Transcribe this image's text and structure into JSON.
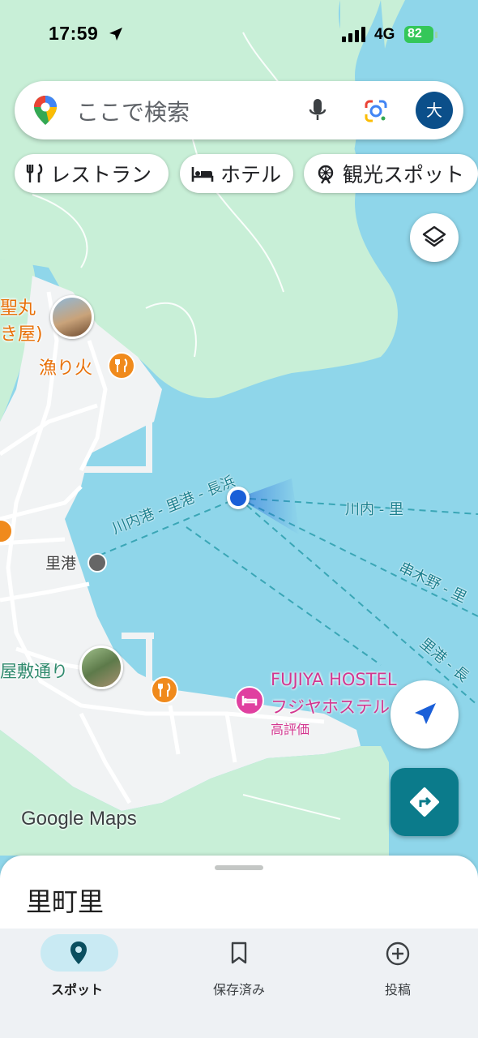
{
  "status_bar": {
    "time": "17:59",
    "network": "4G",
    "battery": "82"
  },
  "search": {
    "placeholder": "ここで検索",
    "avatar_letter": "大"
  },
  "chips": [
    {
      "label": "レストラン",
      "icon": "restaurant-icon"
    },
    {
      "label": "ホテル",
      "icon": "hotel-icon"
    },
    {
      "label": "観光スポット",
      "icon": "attraction-icon"
    }
  ],
  "map": {
    "labels": {
      "seimaru": "聖丸",
      "seimaru_sub": "き屋)",
      "isaribi": "漁り火",
      "satokou": "里港",
      "yashiki": "屋敷通り",
      "hostel_en": "FUJIYA HOSTEL",
      "hostel_jp": "フジヤホステル",
      "hostel_rating": "高評価",
      "watermark": "Google Maps"
    },
    "ferry_routes": {
      "route1": "川内港 - 里港 - 長浜",
      "route2": "川内 - 里",
      "route3": "串木野 - 里",
      "route4": "里港 - 長"
    },
    "colors": {
      "sea": "#8fd6ea",
      "land": "#c8efd7",
      "town": "#f1f3f4",
      "accent": "#0b7b8b",
      "location_dot": "#1a5fd8"
    }
  },
  "sheet": {
    "title": "里町里"
  },
  "bottom_nav": [
    {
      "label": "スポット",
      "icon": "pin-icon",
      "active": true
    },
    {
      "label": "保存済み",
      "icon": "bookmark-icon",
      "active": false
    },
    {
      "label": "投稿",
      "icon": "add-circle-icon",
      "active": false
    }
  ]
}
